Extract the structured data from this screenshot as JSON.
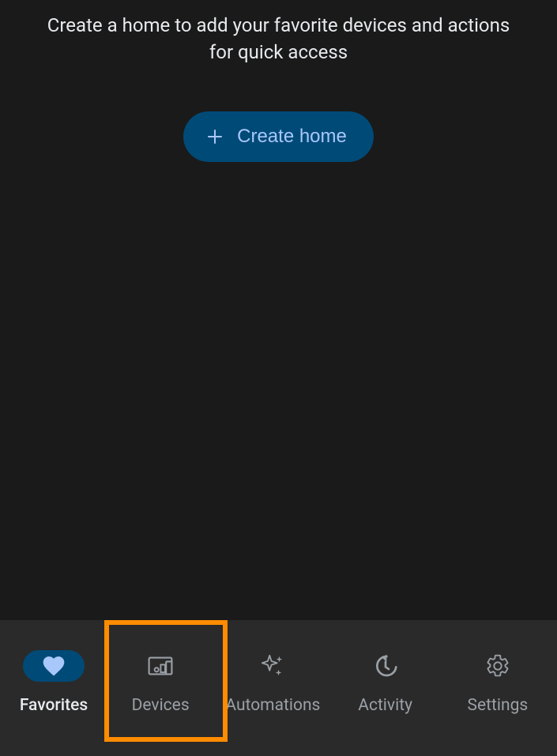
{
  "empty_state": {
    "message": "Create a home to add your favorite devices and actions for quick access",
    "button_label": "Create home"
  },
  "nav": {
    "items": [
      {
        "label": "Favorites",
        "active": true
      },
      {
        "label": "Devices",
        "active": false
      },
      {
        "label": "Automations",
        "active": false
      },
      {
        "label": "Activity",
        "active": false
      },
      {
        "label": "Settings",
        "active": false
      }
    ]
  }
}
